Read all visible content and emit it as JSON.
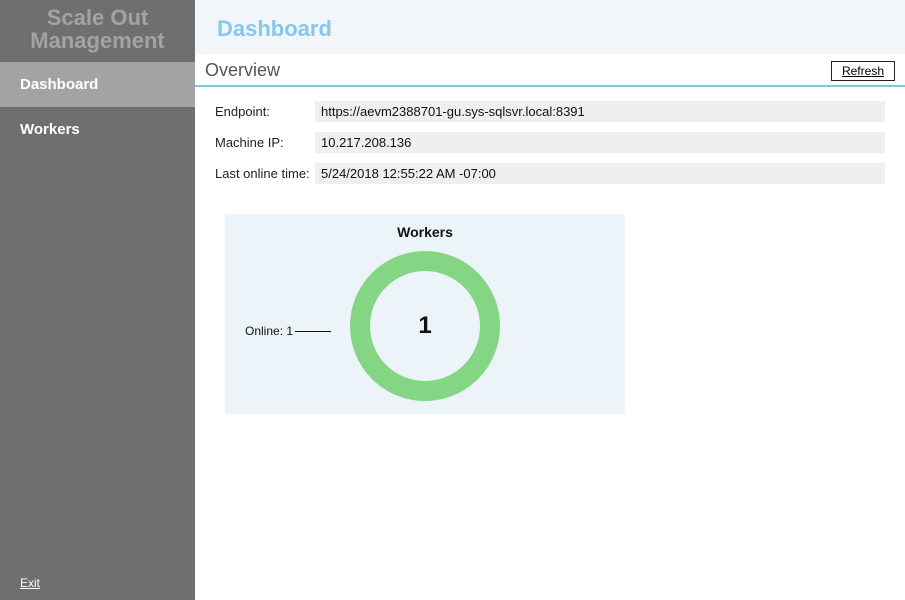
{
  "brand": {
    "line1": "Scale Out",
    "line2": "Management"
  },
  "nav": {
    "items": [
      {
        "label": "Dashboard",
        "active": true
      },
      {
        "label": "Workers",
        "active": false
      }
    ]
  },
  "exit_label": "Exit",
  "page": {
    "title": "Dashboard",
    "section_title": "Overview",
    "refresh_label": "Refresh"
  },
  "fields": {
    "endpoint": {
      "label": "Endpoint:",
      "value": "https://aevm2388701-gu.sys-sqlsvr.local:8391"
    },
    "machine_ip": {
      "label": "Machine IP:",
      "value": "10.217.208.136"
    },
    "last_online": {
      "label": "Last online time:",
      "value": "5/24/2018 12:55:22 AM -07:00"
    }
  },
  "chart_data": {
    "type": "pie",
    "title": "Workers",
    "series": [
      {
        "name": "Online",
        "value": 1
      }
    ],
    "total": 1,
    "center_label": "1",
    "legend_label": "Online: 1",
    "colors": {
      "online": "#84d684"
    }
  }
}
